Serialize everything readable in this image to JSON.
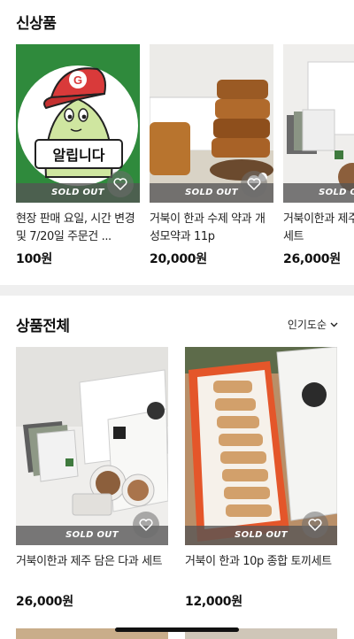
{
  "new_section": {
    "title": "신상품",
    "items": [
      {
        "name": "현장 판매 요일, 시간 변경 및 7/20일 주문건 ...",
        "price": "100원",
        "badge": "SOLD OUT",
        "image_text": "알립니다",
        "cap_letter": "G"
      },
      {
        "name": "거북이 한과 수제 약과 개성모약과 11p",
        "price": "20,000원",
        "badge": "SOLD OUT"
      },
      {
        "name": "거북이한과 제주 담은 다과 세트",
        "price": "26,000원",
        "badge": "SOLD OUT"
      }
    ]
  },
  "all_section": {
    "title": "상품전체",
    "sort_label": "인기도순",
    "items": [
      {
        "name": "거북이한과 제주 담은 다과 세트",
        "price": "26,000원",
        "badge": "SOLD OUT"
      },
      {
        "name": "거북이 한과 10p 종합 토끼세트",
        "price": "12,000원",
        "badge": "SOLD OUT"
      }
    ]
  },
  "icons": {
    "wishlist": "heart-icon",
    "sort": "chevron-down-icon"
  },
  "colors": {
    "notice_green": "#2f8a3c",
    "cap_red": "#d93a3a",
    "box_orange": "#e4562a",
    "soldout_bar": "#555555"
  }
}
